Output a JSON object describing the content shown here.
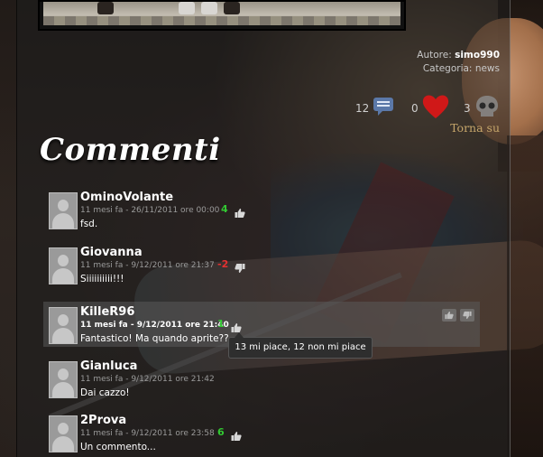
{
  "post_meta": {
    "author_label": "Autore:",
    "author": "simo990",
    "category_label": "Categoria:",
    "category": "news"
  },
  "stats": {
    "comments_count": "12",
    "likes_count": "0",
    "skulls_count": "3"
  },
  "back_to_top": "Torna su",
  "comments_heading": "Commenti",
  "comments": [
    {
      "author": "OminoVolante",
      "date": "11 mesi fa - 26/11/2011 ore 00:00",
      "score": "4",
      "vote_icon": "thumb-up-icon",
      "text": "fsd."
    },
    {
      "author": "Giovanna",
      "date": "11 mesi fa - 9/12/2011 ore 21:37",
      "score": "-2",
      "vote_icon": "thumb-down-icon",
      "text": "Siiiiiiiiii!!!"
    },
    {
      "author": "KilleR96",
      "date": "11 mesi fa - 9/12/2011 ore 21:40",
      "score": "1",
      "vote_icon": "thumb-up-icon",
      "text": "Fantastico! Ma quando aprite??"
    },
    {
      "author": "Gianluca",
      "date": "11 mesi fa - 9/12/2011 ore 21:42",
      "score": "",
      "vote_icon": "",
      "text": "Dai cazzo!"
    },
    {
      "author": "2Prova",
      "date": "11 mesi fa - 9/12/2011 ore 23:58",
      "score": "6",
      "vote_icon": "thumb-up-icon",
      "text": "Un commento..."
    }
  ],
  "tooltip": "13 mi piace, 12 non mi piace",
  "colors": {
    "positive": "#32c832",
    "negative": "#e43030",
    "link_gold": "#c5a56a",
    "heart": "#d01818"
  }
}
